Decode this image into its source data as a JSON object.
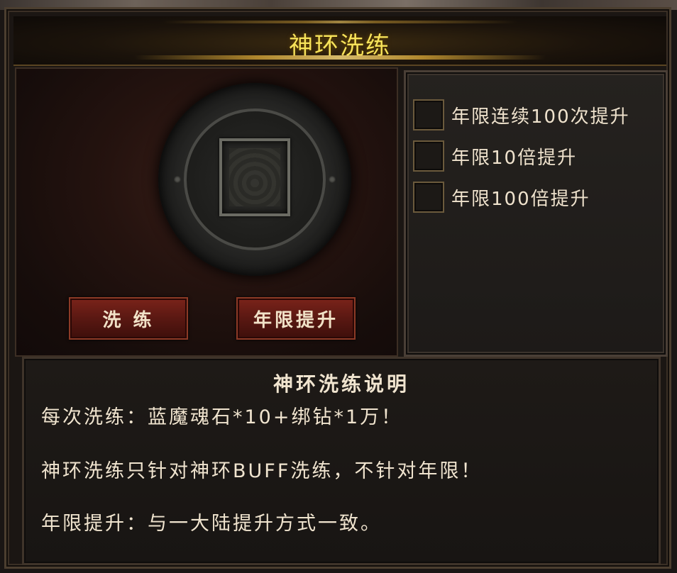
{
  "window": {
    "title": "神环洗练"
  },
  "refine": {
    "refine_button": "洗 练",
    "upgrade_button": "年限提升"
  },
  "options": [
    {
      "label": "年限连续100次提升",
      "checked": false
    },
    {
      "label": "年限10倍提升",
      "checked": false
    },
    {
      "label": "年限100倍提升",
      "checked": false
    }
  ],
  "description": {
    "title": "神环洗练说明",
    "lines": [
      "每次洗练：蓝魔魂石*10+绑钻*1万！",
      "神环洗练只针对神环BUFF洗练，不针对年限！",
      "年限提升：与一大陆提升方式一致。"
    ]
  },
  "colors": {
    "title": "#f6e25a",
    "text": "#f0e4cf",
    "button": "#6a1c14"
  }
}
